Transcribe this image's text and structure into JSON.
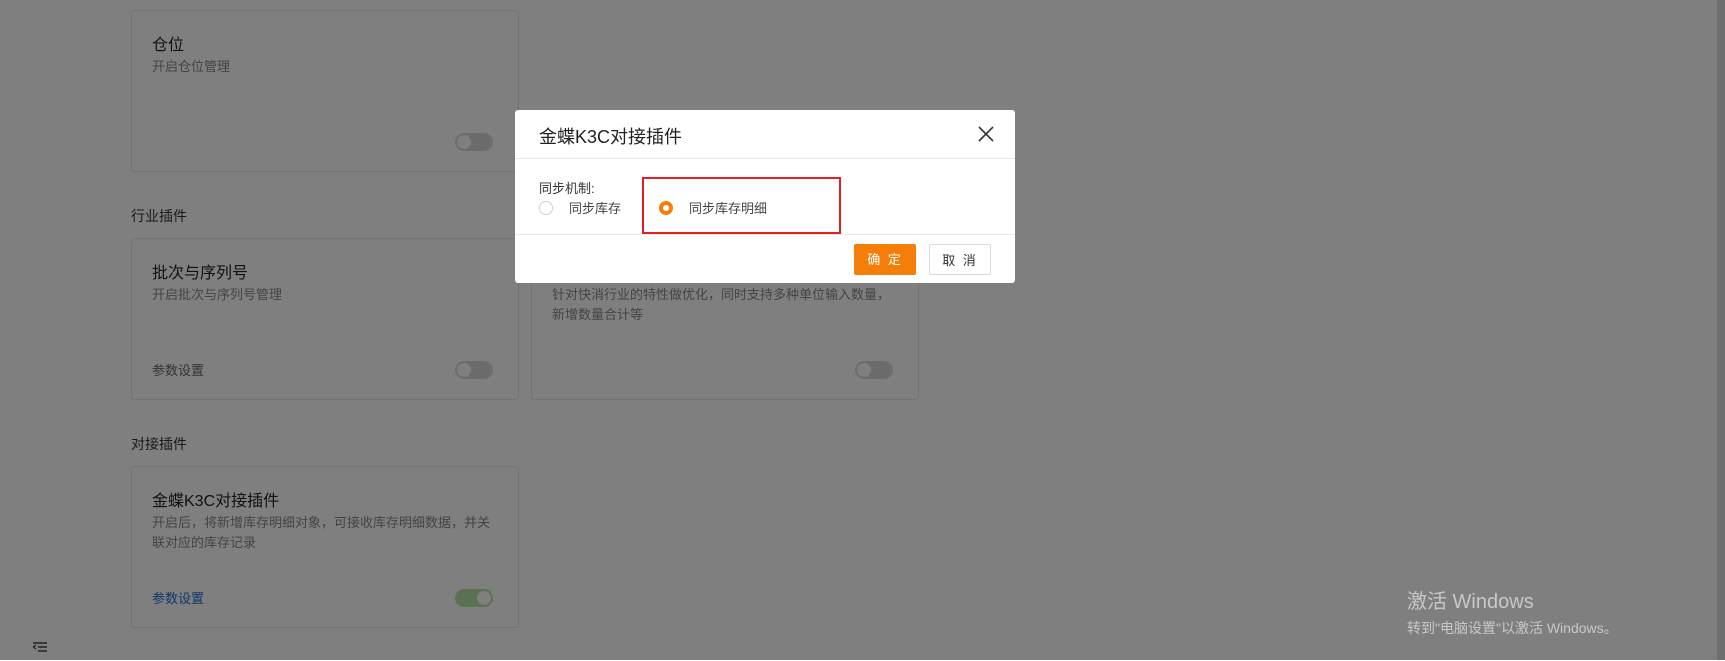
{
  "background": {
    "cards_top": {
      "warehouse": {
        "title": "仓位",
        "desc": "开启仓位管理"
      }
    },
    "section_industry": "行业插件",
    "batch": {
      "title": "批次与序列号",
      "desc": "开启批次与序列号管理",
      "settings": "参数设置"
    },
    "fmcg": {
      "desc": "针对快消行业的特性做优化，同时支持多种单位输入数量，新增数量合计等"
    },
    "section_integration": "对接插件",
    "kingdee": {
      "title": "金蝶K3C对接插件",
      "desc": "开启后，将新增库存明细对象，可接收库存明细数据，并关联对应的库存记录",
      "settings": "参数设置"
    }
  },
  "modal": {
    "title": "金蝶K3C对接插件",
    "label": "同步机制:",
    "options": [
      {
        "label": "同步库存",
        "checked": false
      },
      {
        "label": "同步库存明细",
        "checked": true
      }
    ],
    "ok_label": "确 定",
    "cancel_label": "取 消"
  },
  "watermark": {
    "line1": "激活 Windows",
    "line2": "转到\"电脑设置\"以激活 Windows。"
  },
  "colors": {
    "accent": "#f57e0a",
    "highlight": "#e22020",
    "toggle_on": "#b7e3a6"
  }
}
